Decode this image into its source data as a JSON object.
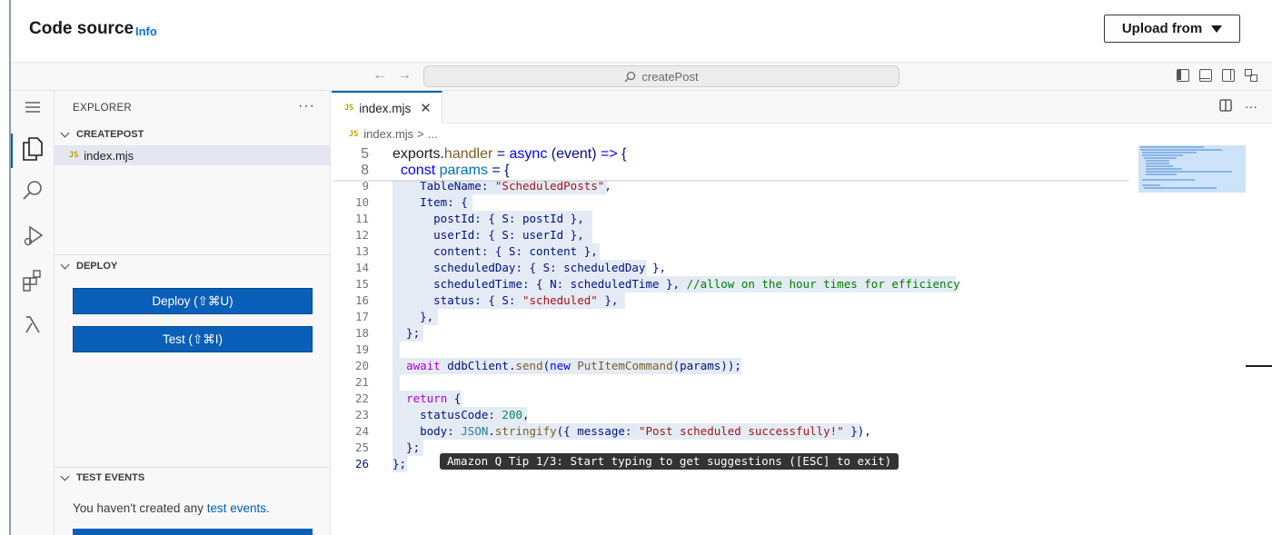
{
  "header": {
    "title": "Code source",
    "info_link": "Info",
    "upload_button": "Upload from"
  },
  "titlebar": {
    "back_icon": "arrow-left-icon",
    "forward_icon": "arrow-right-icon",
    "search_text": "createPost"
  },
  "activity_bar": [
    "menu-icon",
    "files-icon",
    "search-icon",
    "run-debug-icon",
    "extensions-icon",
    "lambda-icon"
  ],
  "sidebar": {
    "title": "EXPLORER",
    "more": "···",
    "folder": "CREATEPOST",
    "file_badge": "JS",
    "file": "index.mjs",
    "deploy_section": "DEPLOY",
    "deploy_button": "Deploy (⇧⌘U)",
    "test_button": "Test (⇧⌘I)",
    "test_events_section": "TEST EVENTS",
    "empty_text": "You haven't created any ",
    "empty_link": "test events",
    "empty_period": "."
  },
  "editor": {
    "tab_badge": "JS",
    "tab_label": "index.mjs",
    "tab_close": "✕",
    "breadcrumb_file": "index.mjs",
    "breadcrumb_sep": ">",
    "breadcrumb_more": "...",
    "tip": "Amazon Q Tip 1/3: Start typing to get suggestions ([ESC] to exit)",
    "current_line": 26
  },
  "colors": {
    "accent": "#005fb8",
    "button": "#0a5fb8",
    "selection": "#e4ebf4",
    "tip_bg": "#333333"
  }
}
